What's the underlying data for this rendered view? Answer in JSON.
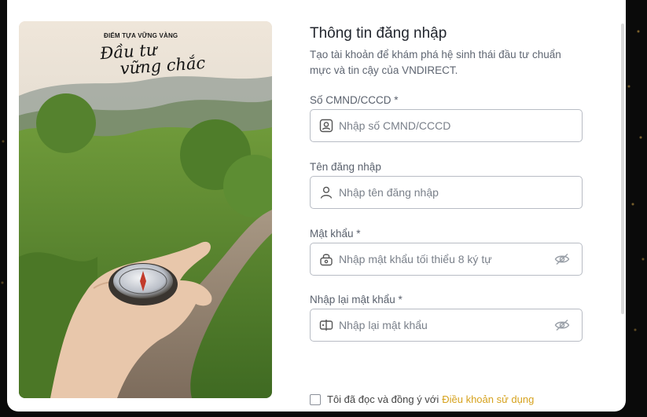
{
  "hero": {
    "tagline": "ĐIỂM TỰA VỮNG VÀNG",
    "title_line1": "Đầu tư",
    "title_line2": "vững chắc"
  },
  "form": {
    "title": "Thông tin đăng nhập",
    "subtitle": "Tạo tài khoản để khám phá hệ sinh thái đầu tư chuẩn mực và tin cậy của VNDIRECT.",
    "fields": [
      {
        "label": "Số CMND/CCCD *",
        "placeholder": "Nhập số CMND/CCCD",
        "value": "",
        "icon": "id-card-icon"
      },
      {
        "label": "Tên đăng nhập",
        "placeholder": "Nhập tên đăng nhập",
        "value": "",
        "icon": "user-icon"
      },
      {
        "label": "Mật khẩu *",
        "placeholder": "Nhập mật khẩu tối thiểu 8 ký tự",
        "value": "",
        "icon": "lock-icon",
        "trailing_icon": "eye-off-icon"
      },
      {
        "label": "Nhập lại mật khẩu *",
        "placeholder": "Nhập lại mật khẩu",
        "value": "",
        "icon": "password-icon",
        "trailing_icon": "eye-off-icon"
      }
    ],
    "agreement_text": "Tôi đã đọc và đồng ý với",
    "agreement_link": "Điều khoản sử dụng"
  },
  "colors": {
    "accent": "#d6a21e",
    "border": "#b8bcc4",
    "title": "#22262e",
    "muted": "#5f6672"
  }
}
